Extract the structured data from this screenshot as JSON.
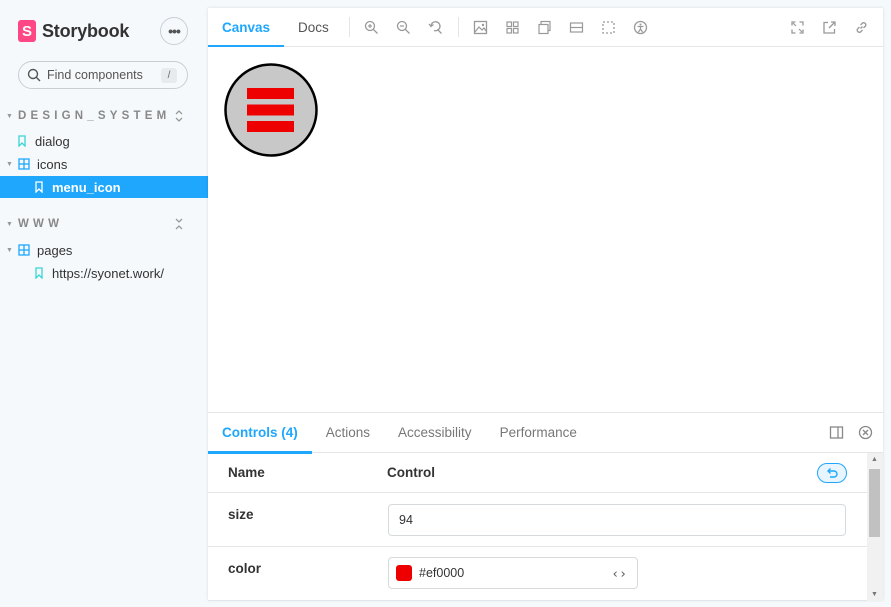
{
  "brand": {
    "logo_letter": "S",
    "name": "Storybook",
    "more": "•••"
  },
  "search": {
    "placeholder": "Find components",
    "shortcut": "/"
  },
  "sidebar": {
    "groups": [
      {
        "title": "DESIGN_SYSTEM"
      },
      {
        "title": "WWW"
      }
    ],
    "items": [
      {
        "label": "dialog",
        "type": "story"
      },
      {
        "label": "icons",
        "type": "component"
      },
      {
        "label": "menu_icon",
        "type": "story",
        "selected": true
      },
      {
        "label": "pages",
        "type": "component"
      },
      {
        "label": "https://syonet.work/",
        "type": "story"
      }
    ]
  },
  "toolbar": {
    "tabs": [
      {
        "label": "Canvas",
        "active": true
      },
      {
        "label": "Docs"
      }
    ],
    "tools": [
      "zoom-in-icon",
      "zoom-out-icon",
      "reset-zoom-icon",
      "background-icon",
      "grid-icon",
      "viewport-icon",
      "measure-icon",
      "outline-icon",
      "accessibility-icon"
    ],
    "right_tools": [
      "fullscreen-icon",
      "open-new-tab-icon",
      "copy-link-icon"
    ]
  },
  "preview": {
    "size": 94,
    "color": "#ef0000",
    "background": "#c8c8c8"
  },
  "panel": {
    "tabs": [
      {
        "label": "Controls (4)",
        "active": true
      },
      {
        "label": "Actions"
      },
      {
        "label": "Accessibility"
      },
      {
        "label": "Performance"
      }
    ],
    "header": {
      "name": "Name",
      "control": "Control"
    },
    "rows": [
      {
        "name": "size",
        "value": "94"
      },
      {
        "name": "color",
        "value": "#ef0000"
      }
    ]
  },
  "colors": {
    "accent": "#1ea7fd",
    "brand": "#ff4785"
  }
}
